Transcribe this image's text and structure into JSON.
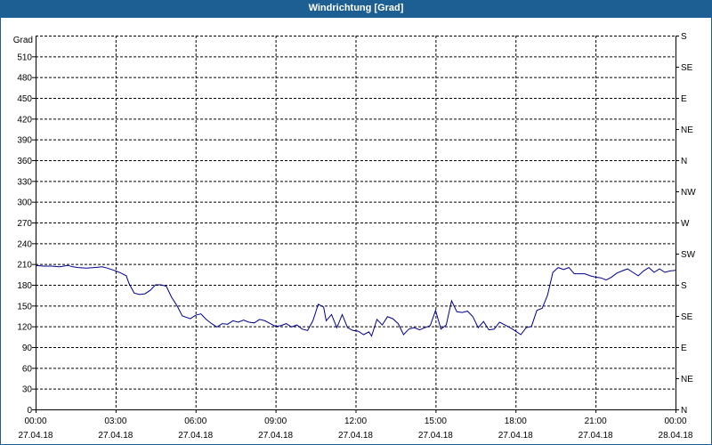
{
  "window": {
    "title": "Windrichtung [Grad]"
  },
  "chart_data": {
    "type": "line",
    "title": "Windrichtung [Grad]",
    "ylabel": "Grad",
    "xlabel": "",
    "ylim": [
      0,
      540
    ],
    "xlim": [
      0,
      24
    ],
    "grid": true,
    "y_ticks": [
      0,
      30,
      60,
      90,
      120,
      150,
      180,
      210,
      240,
      270,
      300,
      330,
      360,
      390,
      420,
      450,
      480,
      510
    ],
    "y_tick_labels": [
      "0",
      "30",
      "60",
      "90",
      "120",
      "150",
      "180",
      "210",
      "240",
      "270",
      "300",
      "330",
      "360",
      "390",
      "420",
      "450",
      "480",
      "510"
    ],
    "right_axis_labels": [
      {
        "value": 0,
        "label": "N"
      },
      {
        "value": 45,
        "label": "NE"
      },
      {
        "value": 90,
        "label": "E"
      },
      {
        "value": 135,
        "label": "SE"
      },
      {
        "value": 180,
        "label": "S"
      },
      {
        "value": 225,
        "label": "SW"
      },
      {
        "value": 270,
        "label": "W"
      },
      {
        "value": 315,
        "label": "NW"
      },
      {
        "value": 360,
        "label": "N"
      },
      {
        "value": 405,
        "label": "NE"
      },
      {
        "value": 450,
        "label": "E"
      },
      {
        "value": 495,
        "label": "SE"
      },
      {
        "value": 540,
        "label": "S"
      }
    ],
    "x_ticks": [
      {
        "x": 0,
        "time": "00:00",
        "date": "27.04.18"
      },
      {
        "x": 3,
        "time": "03:00",
        "date": "27.04.18"
      },
      {
        "x": 6,
        "time": "06:00",
        "date": "27.04.18"
      },
      {
        "x": 9,
        "time": "09:00",
        "date": "27.04.18"
      },
      {
        "x": 12,
        "time": "12:00",
        "date": "27.04.18"
      },
      {
        "x": 15,
        "time": "15:00",
        "date": "27.04.18"
      },
      {
        "x": 18,
        "time": "18:00",
        "date": "27.04.18"
      },
      {
        "x": 21,
        "time": "21:00",
        "date": "27.04.18"
      },
      {
        "x": 24,
        "time": "00:00",
        "date": "28.04.18"
      }
    ],
    "series": [
      {
        "color": "#00008b",
        "x": [
          0,
          0.3,
          0.6,
          0.9,
          1.2,
          1.4,
          1.6,
          1.9,
          2.2,
          2.5,
          2.7,
          3.0,
          3.2,
          3.4,
          3.5,
          3.7,
          3.9,
          4.1,
          4.3,
          4.5,
          4.7,
          4.9,
          5.1,
          5.3,
          5.5,
          5.8,
          6.0,
          6.2,
          6.4,
          6.6,
          6.8,
          7.0,
          7.2,
          7.4,
          7.6,
          7.8,
          8.0,
          8.2,
          8.4,
          8.6,
          8.8,
          9.0,
          9.2,
          9.4,
          9.6,
          9.8,
          10.0,
          10.2,
          10.4,
          10.6,
          10.8,
          10.9,
          11.1,
          11.3,
          11.5,
          11.7,
          11.9,
          12.1,
          12.3,
          12.5,
          12.6,
          12.8,
          13.0,
          13.2,
          13.4,
          13.6,
          13.8,
          14.0,
          14.2,
          14.4,
          14.6,
          14.8,
          15.0,
          15.2,
          15.4,
          15.6,
          15.8,
          16.0,
          16.2,
          16.4,
          16.6,
          16.8,
          17.0,
          17.2,
          17.4,
          17.6,
          17.8,
          18.0,
          18.2,
          18.4,
          18.6,
          18.8,
          19.0,
          19.2,
          19.4,
          19.6,
          19.8,
          20.0,
          20.2,
          20.4,
          20.6,
          20.8,
          21.0,
          21.2,
          21.4,
          21.6,
          21.8,
          22.0,
          22.2,
          22.4,
          22.6,
          22.8,
          23.0,
          23.2,
          23.4,
          23.6,
          23.8,
          24.0
        ],
        "values": [
          208,
          207,
          207,
          206,
          208,
          206,
          205,
          204,
          205,
          206,
          204,
          200,
          197,
          193,
          182,
          168,
          166,
          167,
          172,
          180,
          180,
          178,
          162,
          150,
          135,
          131,
          136,
          138,
          130,
          124,
          119,
          124,
          123,
          128,
          126,
          129,
          126,
          125,
          130,
          128,
          124,
          120,
          121,
          124,
          119,
          122,
          116,
          114,
          128,
          152,
          148,
          128,
          137,
          118,
          137,
          118,
          114,
          113,
          108,
          112,
          106,
          130,
          122,
          134,
          131,
          124,
          108,
          116,
          118,
          115,
          118,
          121,
          143,
          116,
          122,
          157,
          141,
          140,
          142,
          134,
          118,
          127,
          115,
          116,
          126,
          122,
          118,
          113,
          108,
          118,
          120,
          143,
          146,
          165,
          198,
          205,
          202,
          205,
          196,
          196,
          196,
          193,
          191,
          190,
          187,
          191,
          197,
          200,
          203,
          198,
          193,
          200,
          205,
          198,
          203,
          198,
          200,
          201
        ]
      }
    ]
  }
}
